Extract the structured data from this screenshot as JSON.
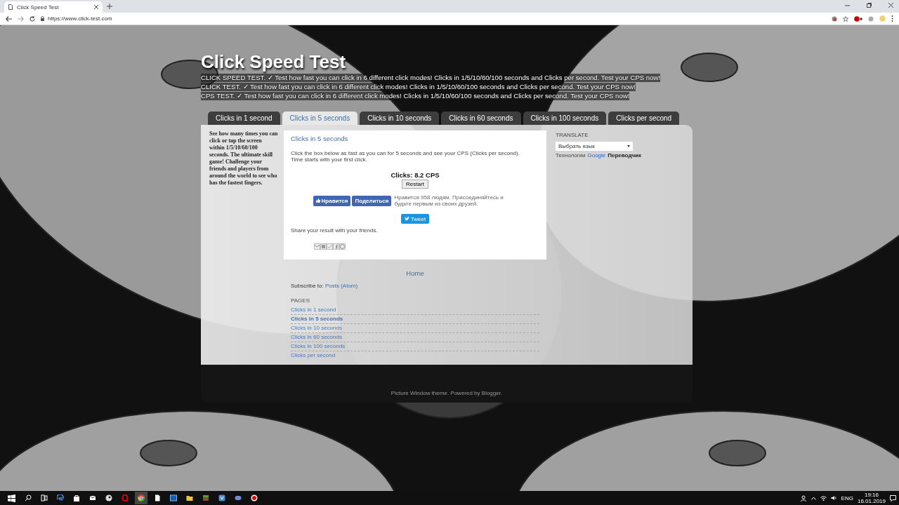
{
  "browser": {
    "tab_title": "Click Speed Test",
    "url": "https://www.click-test.com"
  },
  "header": {
    "title": "Click Speed Test",
    "description": [
      "CLICK SPEED TEST. ✓ Test how fast you can click in 6 different click modes! Clicks in 1/5/10/60/100 seconds and Clicks per second. Test your CPS now!",
      "CLICK TEST. ✓ Test how fast you can click in 6 different click modes! Clicks in 1/5/10/60/100 seconds and Clicks per second. Test your CPS now!",
      "CPS TEST. ✓ Test how fast you can click in 6 different click modes! Clicks in 1/5/10/60/100 seconds and Clicks per second. Test your CPS now!"
    ]
  },
  "tabs": [
    {
      "label": "Clicks in 1 second",
      "selected": false
    },
    {
      "label": "Clicks in 5 seconds",
      "selected": true
    },
    {
      "label": "Clicks in 10 seconds",
      "selected": false
    },
    {
      "label": "Clicks in 60 seconds",
      "selected": false
    },
    {
      "label": "Clicks in 100 seconds",
      "selected": false
    },
    {
      "label": "Clicks per second",
      "selected": false
    }
  ],
  "sidebar_text": "See how many times you can click or tap the screen within 1/5/10/60/100 seconds. The ultimate skill game! Challenge your friends and players from around the world to see who has the fastest fingers.",
  "post": {
    "title": "Clicks in 5 seconds",
    "body": [
      "Click the box below as fast as you can for 5 seconds and see your CPS (Clicks per second).",
      "Time starts with your first click."
    ],
    "result": "Clicks: 8.2 CPS",
    "restart_button": "Restart",
    "like_button": "Нравится",
    "share_button": "Поделиться",
    "like_note": "Нравится 958 людям. Присоединяйтесь и будьте первым из своих друзей.",
    "tweet_button": "Tweet",
    "share_text": "Share your result with your friends."
  },
  "home_link": "Home",
  "subscribe": {
    "label": "Subscribe to:",
    "link": "Posts (Atom)"
  },
  "pages": {
    "heading": "PAGES",
    "items": [
      {
        "label": "Clicks in 1 second",
        "selected": false
      },
      {
        "label": "Clicks in 5 seconds",
        "selected": true
      },
      {
        "label": "Clicks in 10 seconds",
        "selected": false
      },
      {
        "label": "Clicks in 60 seconds",
        "selected": false
      },
      {
        "label": "Clicks in 100 seconds",
        "selected": false
      },
      {
        "label": "Clicks per second",
        "selected": false
      }
    ]
  },
  "translate": {
    "heading": "TRANSLATE",
    "select_value": "Выбрать язык",
    "powered_prefix": "Технологии",
    "powered_brand": "Google",
    "powered_service": "Переводчик"
  },
  "footer": "Picture Window theme. Powered by Blogger.",
  "taskbar": {
    "language": "ENG",
    "time": "19:16",
    "date": "16.01.2019"
  }
}
